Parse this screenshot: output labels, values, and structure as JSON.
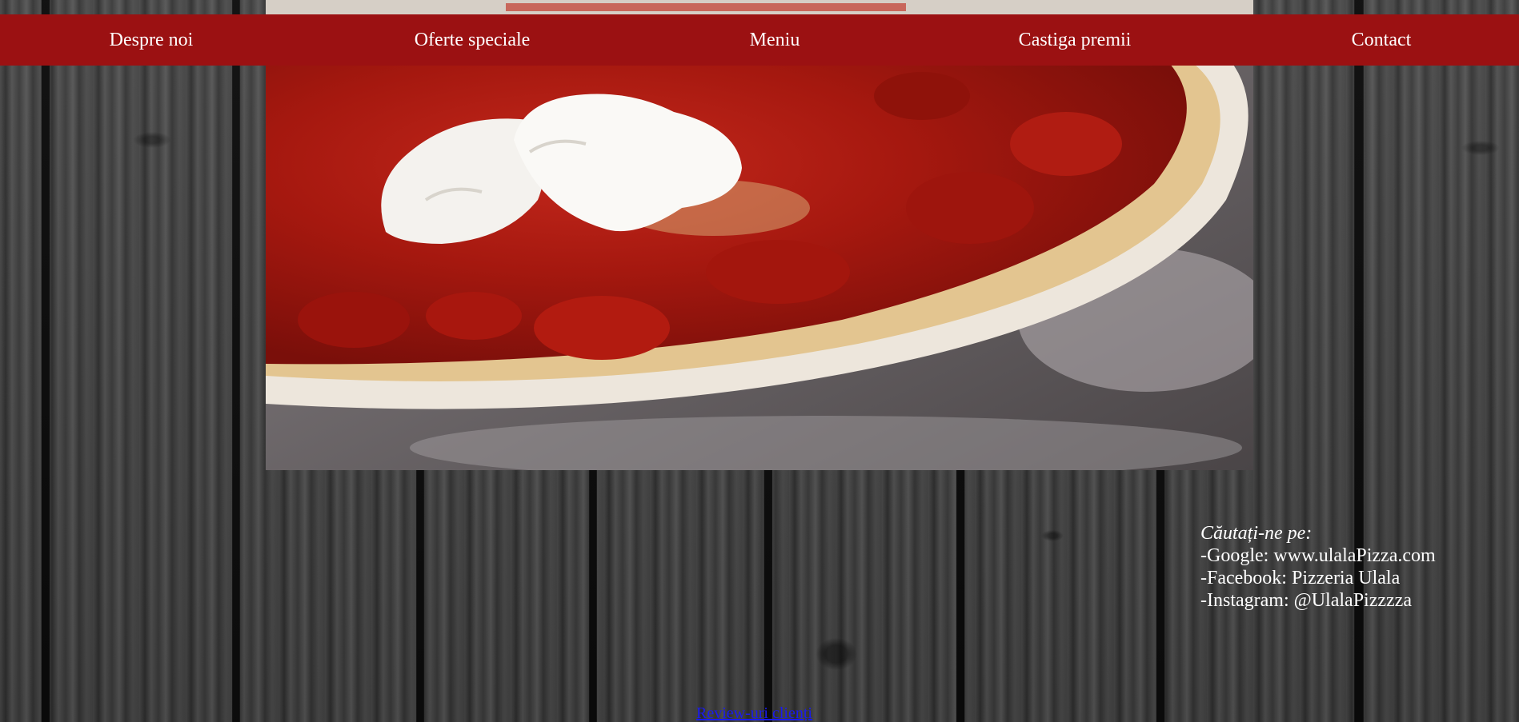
{
  "nav": {
    "items": [
      {
        "label": "Despre noi"
      },
      {
        "label": "Oferte speciale"
      },
      {
        "label": "Meniu"
      },
      {
        "label": "Castiga premii"
      },
      {
        "label": "Contact"
      }
    ]
  },
  "search_info": {
    "heading": "Căutați-ne pe:",
    "google": "-Google: www.ulalaPizza.com",
    "facebook": "-Facebook: Pizzeria Ulala",
    "instagram": "-Instagram: @UlalaPizzzza"
  },
  "footer": {
    "review_link": "Review-uri clienți"
  },
  "colors": {
    "nav_background": "#9b1112",
    "nav_text": "#ffffff",
    "link": "#1a1aee"
  }
}
